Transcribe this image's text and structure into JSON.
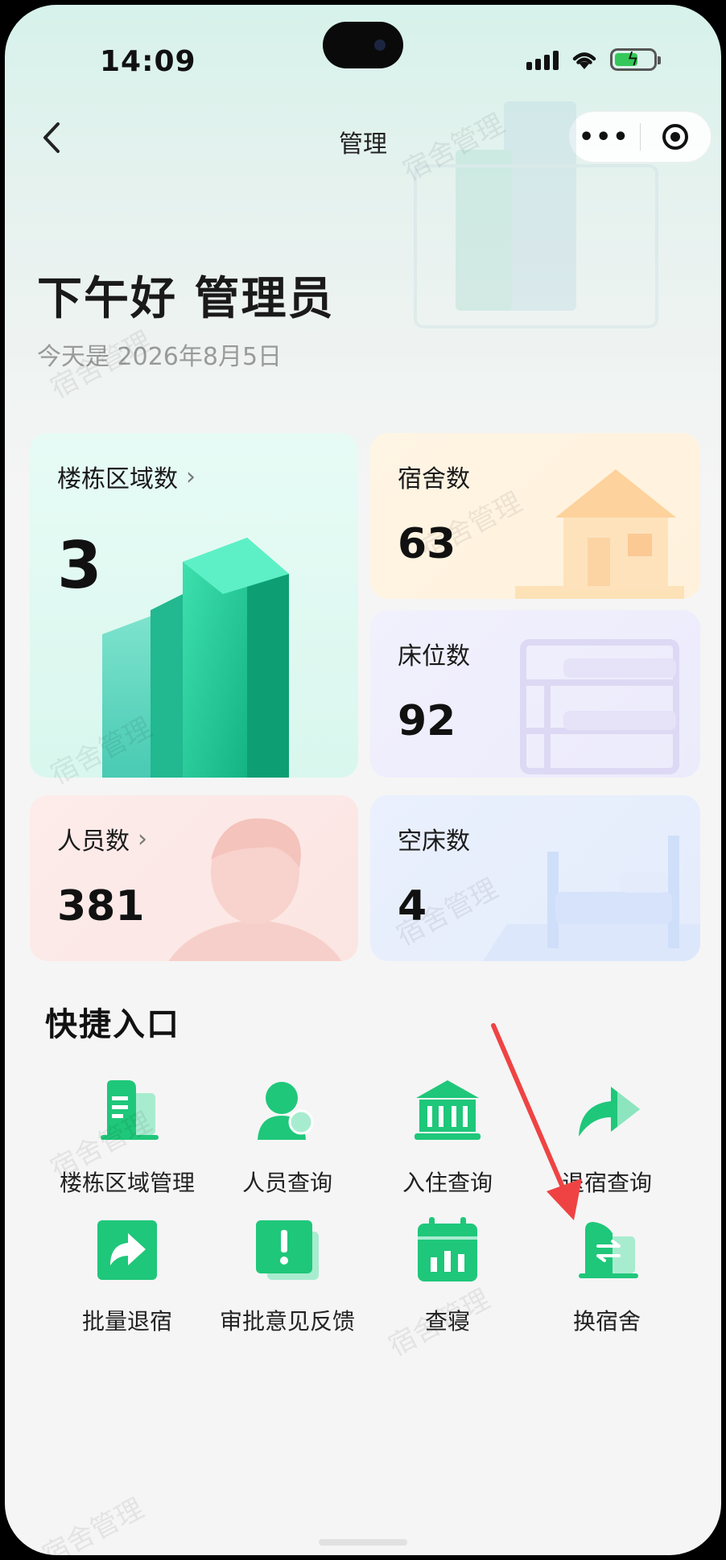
{
  "status_bar": {
    "time": "14:09"
  },
  "nav": {
    "title": "管理"
  },
  "watermark_text": "宿舍管理",
  "greeting": {
    "title": "下午好 管理员",
    "date": "今天是 2026年8月5日"
  },
  "stats": {
    "buildings": {
      "label": "楼栋区域数",
      "value": "3"
    },
    "dorms": {
      "label": "宿舍数",
      "value": "63"
    },
    "beds": {
      "label": "床位数",
      "value": "92"
    },
    "people": {
      "label": "人员数",
      "value": "381"
    },
    "empty_beds": {
      "label": "空床数",
      "value": "4"
    }
  },
  "quick": {
    "title": "快捷入口",
    "items": [
      {
        "label": "楼栋区域管理",
        "icon": "building-doc-icon"
      },
      {
        "label": "人员查询",
        "icon": "person-search-icon"
      },
      {
        "label": "入住查询",
        "icon": "bank-building-icon"
      },
      {
        "label": "退宿查询",
        "icon": "forward-arrow-icon"
      },
      {
        "label": "批量退宿",
        "icon": "share-arrow-icon"
      },
      {
        "label": "审批意见反馈",
        "icon": "exclamation-card-icon"
      },
      {
        "label": "查寝",
        "icon": "calendar-chart-icon"
      },
      {
        "label": "换宿舍",
        "icon": "swap-dorm-icon"
      }
    ]
  },
  "colors": {
    "accent_green": "#1fc77a",
    "annotation_red": "#ef4343"
  }
}
